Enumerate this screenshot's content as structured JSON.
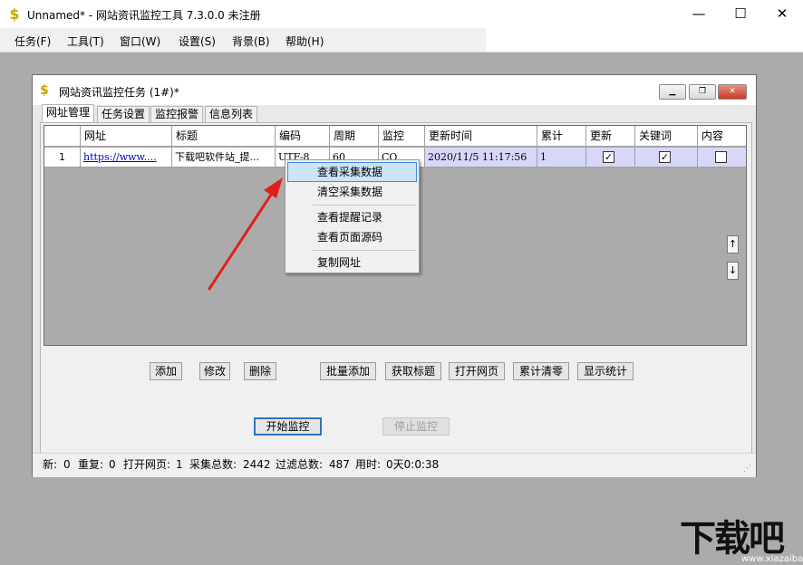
{
  "window": {
    "title": "Unnamed* - 网站资讯监控工具 7.3.0.0  未注册",
    "minimize": "—",
    "maximize": "☐",
    "close": "✕",
    "icon": "dollar-app-icon"
  },
  "menu": [
    "任务(F)",
    "工具(T)",
    "窗口(W)",
    "设置(S)",
    "背景(B)",
    "帮助(H)"
  ],
  "child": {
    "title": "网站资讯监控任务  (1#)*",
    "tabs": [
      "网址管理",
      "任务设置",
      "监控报警",
      "信息列表"
    ],
    "active_tab": "网址管理"
  },
  "grid": {
    "columns": [
      "网址",
      "标题",
      "编码",
      "周期",
      "监控",
      "更新时间",
      "累计",
      "更新",
      "关键词",
      "内容"
    ],
    "rows": [
      {
        "index": "1",
        "url": "https://www....",
        "title": "下载吧软件站_提...",
        "encoding": "UTF-8",
        "period": "60",
        "monitor": "CO",
        "updated": "2020/11/5 11:17:56",
        "total": "1",
        "update_checked": true,
        "keyword_checked": true,
        "content_checked": false
      }
    ],
    "up": "↑",
    "down": "↓"
  },
  "context_menu": {
    "items": [
      "查看采集数据",
      "清空采集数据",
      "查看提醒记录",
      "查看页面源码",
      "复制网址"
    ],
    "selected": "查看采集数据"
  },
  "buttons": {
    "add": "添加",
    "edit": "修改",
    "delete": "删除",
    "batch_add": "批量添加",
    "fetch_title": "获取标题",
    "open_page": "打开网页",
    "reset_total": "累计清零",
    "show_stats": "显示统计",
    "start": "开始监控",
    "stop": "停止监控"
  },
  "status": {
    "new_label": "新:",
    "new": "0",
    "dup_label": "重复:",
    "dup": "0",
    "open_label": "打开网页:",
    "open": "1",
    "collect_label": "采集总数:",
    "collect": "2442",
    "filter_label": "过滤总数:",
    "filter": "487",
    "time_label": "用时:",
    "time": "0天0:0:38"
  },
  "watermark": {
    "logo": "下载吧",
    "url": "www.xiazaiba.com"
  },
  "colors": {
    "row_highlight": "#d7d7f8",
    "menu_selected": "#cde3f8",
    "arrow": "#e02020",
    "link": "#0000cc"
  }
}
